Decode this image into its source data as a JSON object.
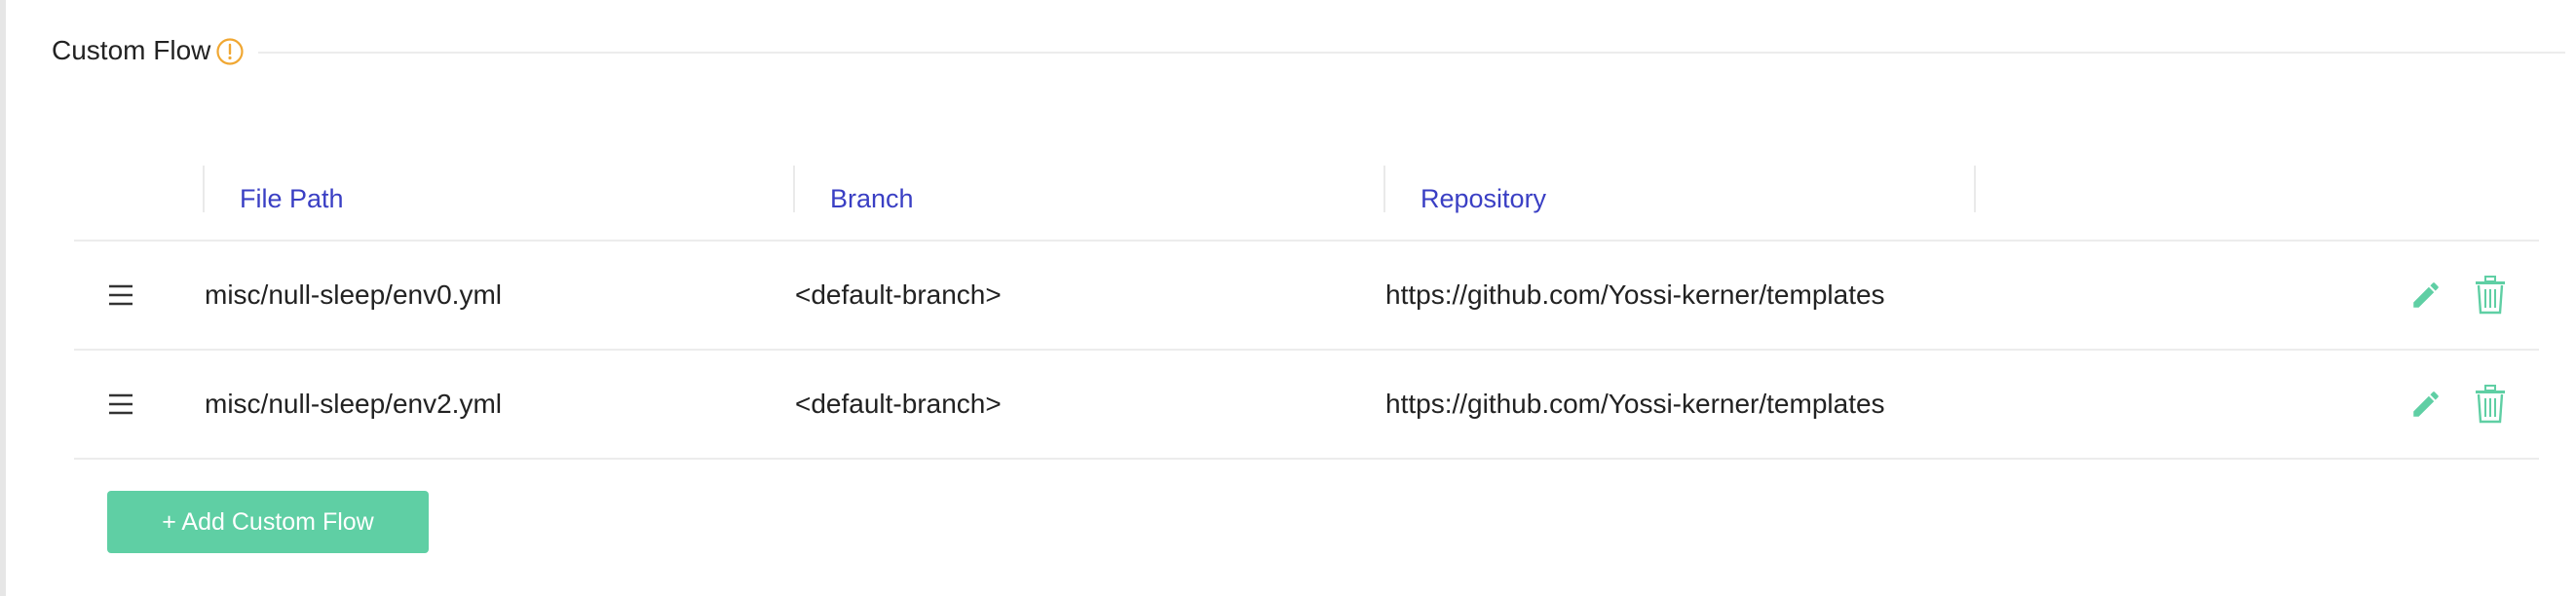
{
  "section": {
    "title": "Custom Flow",
    "info_icon": "warning-circle-icon"
  },
  "table": {
    "headers": [
      "File Path",
      "Branch",
      "Repository"
    ],
    "rows": [
      {
        "file_path": "misc/null-sleep/env0.yml",
        "branch": "<default-branch>",
        "repository": "https://github.com/Yossi-kerner/templates"
      },
      {
        "file_path": "misc/null-sleep/env2.yml",
        "branch": "<default-branch>",
        "repository": "https://github.com/Yossi-kerner/templates"
      }
    ],
    "row_icons": {
      "drag": "drag-handle-icon",
      "edit": "pencil-icon",
      "delete": "trash-icon"
    }
  },
  "add_button": {
    "label": "+ Add Custom Flow"
  },
  "colors": {
    "header_text": "#3a3fc4",
    "accent_green": "#5fcfa4",
    "warning": "#f0a732"
  }
}
